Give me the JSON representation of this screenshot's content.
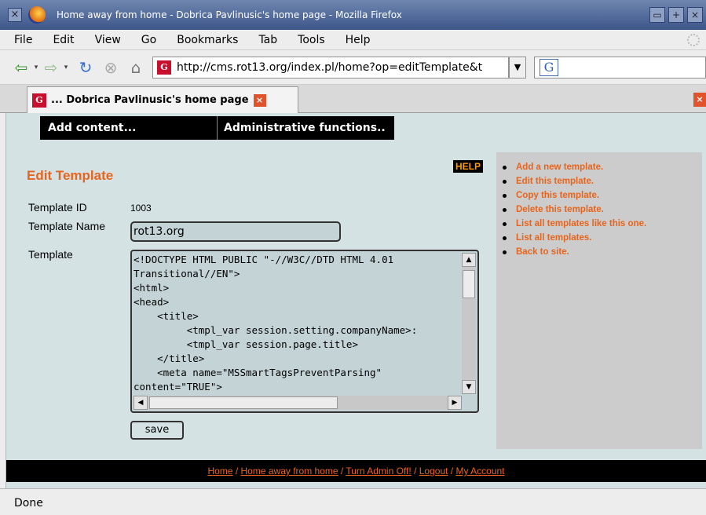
{
  "window": {
    "title": "Home away from home - Dobrica Pavlinusic's home page - Mozilla Firefox",
    "close_glyph": "×",
    "wbtn_min": "▭",
    "wbtn_max": "+",
    "wbtn_close": "×"
  },
  "menu": [
    "File",
    "Edit",
    "View",
    "Go",
    "Bookmarks",
    "Tab",
    "Tools",
    "Help"
  ],
  "nav": {
    "back": "⇦",
    "forward": "⇨",
    "reload": "↻",
    "stop": "⊗",
    "home": "⌂",
    "drop": "▾",
    "favicon": "G",
    "url": "http://cms.rot13.org/index.pl/home?op=editTemplate&t",
    "url_drop": "▼",
    "search_logo": "G"
  },
  "tab": {
    "favicon": "G",
    "label": "... Dobrica Pavlinusic's home page",
    "close": "×",
    "close_right": "×"
  },
  "admin_bar": {
    "add_content": "Add content...",
    "admin_functions": "Administrative functions.."
  },
  "form": {
    "heading": "Edit Template",
    "help": "HELP",
    "template_id_label": "Template ID",
    "template_id_value": "1003",
    "template_name_label": "Template Name",
    "template_name_value": "rot13.org",
    "template_label": "Template",
    "template_code": "<!DOCTYPE HTML PUBLIC \"-//W3C//DTD HTML 4.01\nTransitional//EN\">\n<html>\n<head>\n    <title>\n         <tmpl_var session.setting.companyName>:\n         <tmpl_var session.page.title>\n    </title>\n    <meta name=\"MSSmartTagsPreventParsing\"\ncontent=\"TRUE\">",
    "save": "save",
    "scroll_up": "▲",
    "scroll_down": "▼",
    "scroll_left": "◀",
    "scroll_right": "▶"
  },
  "sidebar": {
    "links": [
      "Add a new template.",
      "Edit this template.",
      "Copy this template.",
      "Delete this template.",
      "List all templates like this one.",
      "List all templates.",
      "Back to site."
    ]
  },
  "footer": {
    "links": [
      "Home",
      "Home away from home",
      "Turn Admin Off!",
      "Logout",
      "My Account"
    ],
    "separator": " / "
  },
  "status": "Done",
  "colors": {
    "accent": "#e8641c",
    "page_bg": "#d4e2e4",
    "sidebar_bg": "#cccccc",
    "bar_bg": "#000000"
  }
}
